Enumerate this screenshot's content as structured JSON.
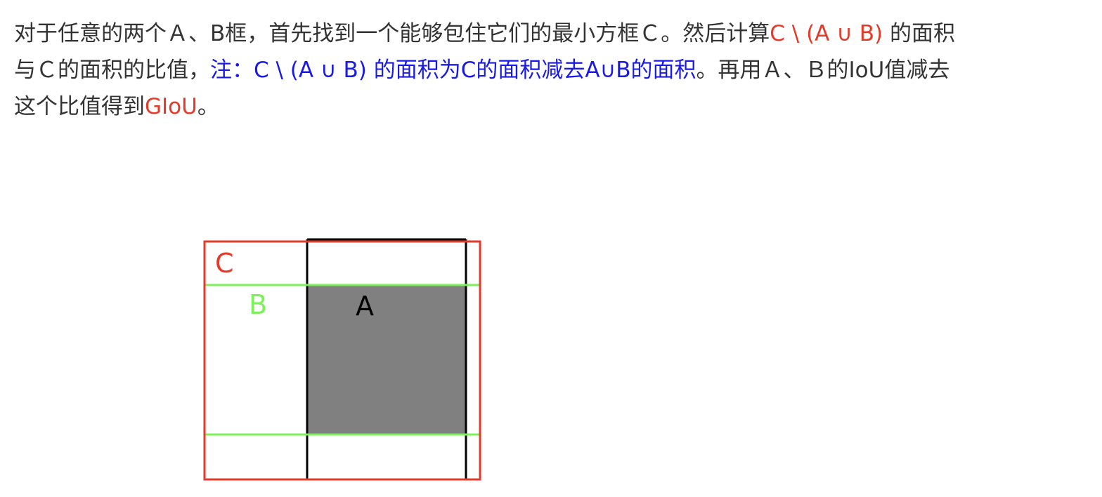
{
  "text": {
    "line1": {
      "before": "对于任意的两个Ａ、B框，首先找到一个能够包住它们的最小方框Ｃ。然后计算",
      "red": "C \\ (A ∪ B)",
      "after": " 的面积"
    },
    "line2": {
      "before": "与Ｃ的面积的比值，",
      "blue": "注：C \\ (A ∪ B) 的面积为C的面积减去A∪B的面积",
      "after": "。再用Ａ、Ｂ的IoU值减去"
    },
    "line3": {
      "before": "这个比值得到",
      "red": "GIoU",
      "after": "。"
    }
  },
  "diagram": {
    "labels": {
      "c": "C",
      "b": "B",
      "a": "A"
    },
    "colors": {
      "c_box": "#e53a2a",
      "b_box": "#7cf25a",
      "a_box": "#000000",
      "intersection_fill": "#808080",
      "highlight_red": "#e53a2a",
      "highlight_blue": "#1a1ae6"
    }
  }
}
